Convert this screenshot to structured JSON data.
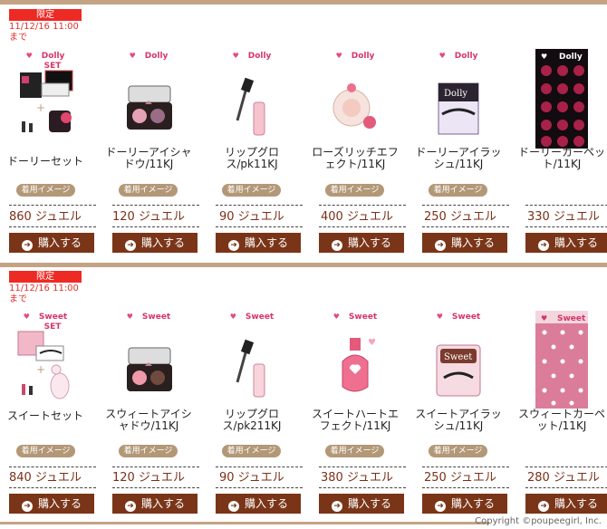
{
  "sections": [
    {
      "limited_label": "限定",
      "date": "11/12/16 11:00",
      "until": "まで",
      "items": [
        {
          "brand": "Dolly",
          "brand_line2": "SET",
          "name": "ドーリーセット",
          "tryon": "着用イメージ",
          "price": "860 ジュエル",
          "buy": "購入する"
        },
        {
          "brand": "Dolly",
          "name": "ドーリーアイシャドウ/11KJ",
          "tryon": "着用イメージ",
          "price": "120 ジュエル",
          "buy": "購入する"
        },
        {
          "brand": "Dolly",
          "name": "リップグロス/pk11KJ",
          "tryon": "着用イメージ",
          "price": "90 ジュエル",
          "buy": "購入する"
        },
        {
          "brand": "Dolly",
          "name": "ローズリッチエフェクト/11KJ",
          "tryon": "着用イメージ",
          "price": "400 ジュエル",
          "buy": "購入する"
        },
        {
          "brand": "Dolly",
          "name": "ドーリーアイラッシュ/11KJ",
          "tryon": "着用イメージ",
          "price": "250 ジュエル",
          "buy": "購入する"
        },
        {
          "brand": "Dolly",
          "name": "ドーリーカーペット/11KJ",
          "price": "330 ジュエル",
          "buy": "購入する"
        }
      ]
    },
    {
      "limited_label": "限定",
      "date": "11/12/16 11:00",
      "until": "まで",
      "items": [
        {
          "brand": "Sweet",
          "brand_line2": "SET",
          "name": "スイートセット",
          "tryon": "着用イメージ",
          "price": "840 ジュエル",
          "buy": "購入する"
        },
        {
          "brand": "Sweet",
          "name": "スウィートアイシャドウ/11KJ",
          "tryon": "着用イメージ",
          "price": "120 ジュエル",
          "buy": "購入する"
        },
        {
          "brand": "Sweet",
          "name": "リップグロス/pk211KJ",
          "tryon": "着用イメージ",
          "price": "90 ジュエル",
          "buy": "購入する"
        },
        {
          "brand": "Sweet",
          "name": "スイートハートエフェクト/11KJ",
          "tryon": "着用イメージ",
          "price": "380 ジュエル",
          "buy": "購入する"
        },
        {
          "brand": "Sweet",
          "name": "スイートアイラッシュ/11KJ",
          "tryon": "着用イメージ",
          "price": "250 ジュエル",
          "buy": "購入する"
        },
        {
          "brand": "Sweet",
          "name": "スウィートカーペット/11KJ",
          "price": "280 ジュエル",
          "buy": "購入する"
        }
      ]
    }
  ],
  "copyright": "Copyright ©poupeegirl, Inc."
}
